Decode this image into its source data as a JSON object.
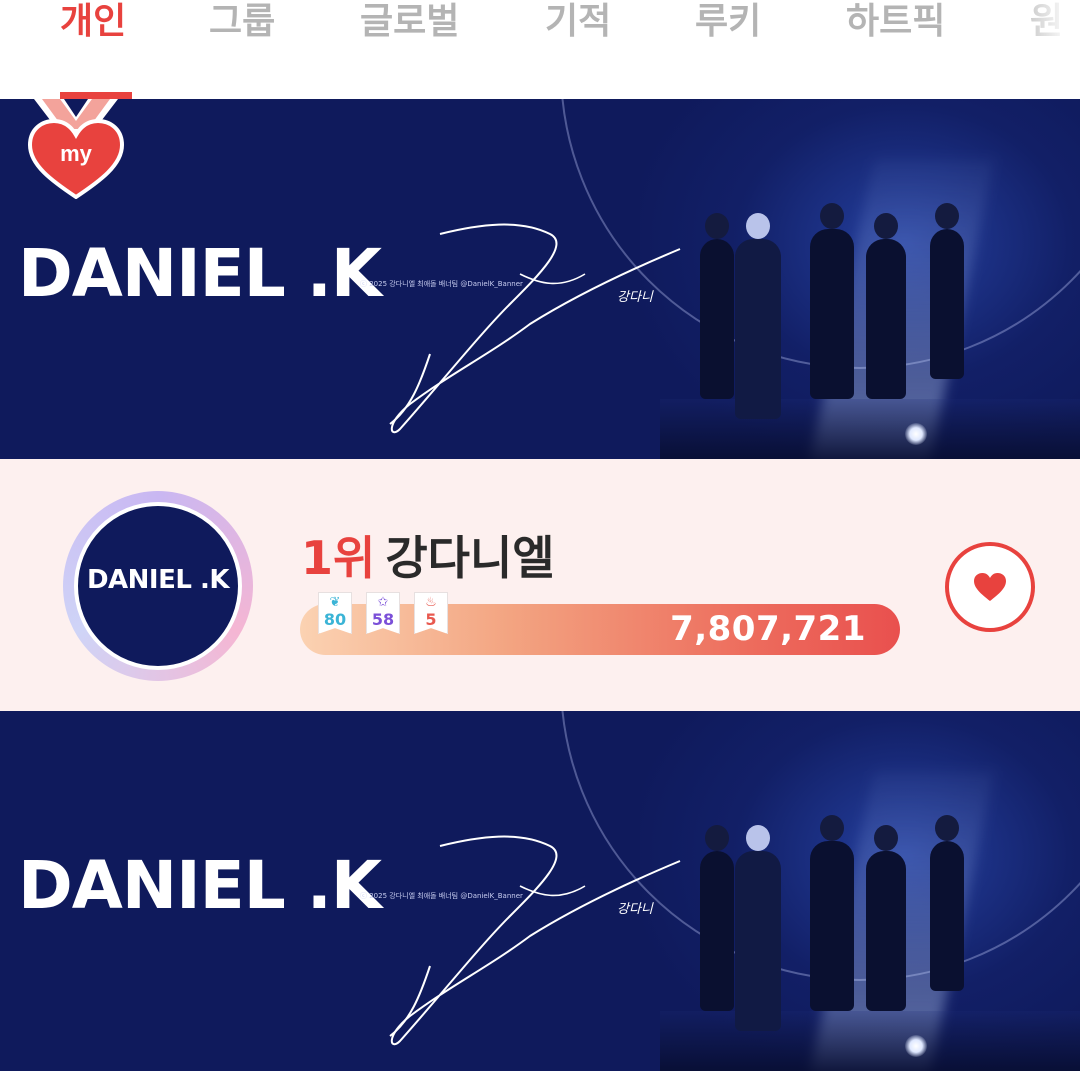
{
  "tabs": [
    {
      "label": "개인",
      "active": true
    },
    {
      "label": "그룹",
      "active": false
    },
    {
      "label": "글로벌",
      "active": false
    },
    {
      "label": "기적",
      "active": false
    },
    {
      "label": "루키",
      "active": false
    },
    {
      "label": "하트픽",
      "active": false
    },
    {
      "label": "원",
      "active": false
    }
  ],
  "badge": {
    "label": "my",
    "icon": "heart-medal-icon"
  },
  "banner": {
    "title": "DANIEL .K",
    "copyright": "ⓒ 2025 강다니엘 최애돌 배너팀 @DanielK_Banner",
    "signature_tag": "강다니"
  },
  "rank_card": {
    "avatar_text": "DANIEL .K",
    "rank": "1위",
    "name": "강다니엘",
    "medals": [
      {
        "icon": "angel-wing-icon",
        "count": "80",
        "color": "#3bb4d6"
      },
      {
        "icon": "star-icon",
        "count": "58",
        "color": "#7b50d8"
      },
      {
        "icon": "cake-icon",
        "count": "5",
        "color": "#e8594f"
      }
    ],
    "score": "7,807,721",
    "vote_icon": "heart-icon"
  },
  "colors": {
    "accent": "#e8423e",
    "banner_bg": "#0f1a5c",
    "card_bg": "#fdf0ef",
    "inactive_tab": "#b4b4b4"
  }
}
